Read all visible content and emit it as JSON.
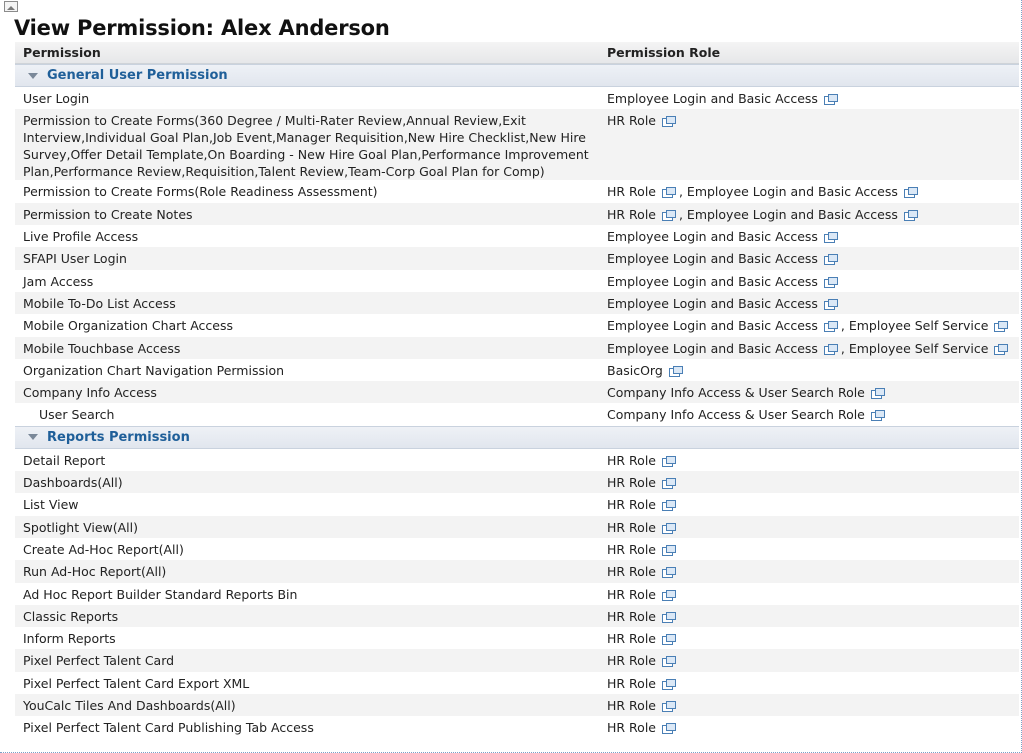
{
  "page": {
    "title": "View Permission: Alex Anderson"
  },
  "table": {
    "col_permission": "Permission",
    "col_role": "Permission Role"
  },
  "sections": [
    {
      "title": "General User Permission",
      "rows": [
        {
          "permission": "User Login",
          "roles": [
            "Employee Login and Basic Access"
          ]
        },
        {
          "permission": "Permission to Create Forms(360 Degree / Multi-Rater Review,Annual Review,Exit Interview,Individual Goal Plan,Job Event,Manager Requisition,New Hire Checklist,New Hire Survey,Offer Detail Template,On Boarding - New Hire Goal Plan,Performance Improvement Plan,Performance Review,Requisition,Talent Review,Team-Corp Goal Plan for Comp)",
          "roles": [
            "HR Role"
          ]
        },
        {
          "permission": "Permission to Create Forms(Role Readiness Assessment)",
          "roles": [
            "HR Role",
            "Employee Login and Basic Access"
          ]
        },
        {
          "permission": "Permission to Create Notes",
          "roles": [
            "HR Role",
            "Employee Login and Basic Access"
          ]
        },
        {
          "permission": "Live Profile Access",
          "roles": [
            "Employee Login and Basic Access"
          ]
        },
        {
          "permission": "SFAPI User Login",
          "roles": [
            "Employee Login and Basic Access"
          ]
        },
        {
          "permission": "Jam Access",
          "roles": [
            "Employee Login and Basic Access"
          ]
        },
        {
          "permission": "Mobile To-Do List Access",
          "roles": [
            "Employee Login and Basic Access"
          ]
        },
        {
          "permission": "Mobile Organization Chart Access",
          "roles": [
            "Employee Login and Basic Access",
            "Employee Self Service"
          ]
        },
        {
          "permission": "Mobile Touchbase Access",
          "roles": [
            "Employee Login and Basic Access",
            "Employee Self Service"
          ]
        },
        {
          "permission": "Organization Chart Navigation Permission",
          "roles": [
            "BasicOrg"
          ]
        },
        {
          "permission": "Company Info Access",
          "roles": [
            "Company Info Access & User Search Role"
          ]
        },
        {
          "permission": "User Search",
          "roles": [
            "Company Info Access & User Search Role"
          ],
          "indent": true
        }
      ]
    },
    {
      "title": "Reports Permission",
      "rows": [
        {
          "permission": "Detail Report",
          "roles": [
            "HR Role"
          ]
        },
        {
          "permission": "Dashboards(All)",
          "roles": [
            "HR Role"
          ]
        },
        {
          "permission": "List View",
          "roles": [
            "HR Role"
          ]
        },
        {
          "permission": "Spotlight View(All)",
          "roles": [
            "HR Role"
          ]
        },
        {
          "permission": "Create Ad-Hoc Report(All)",
          "roles": [
            "HR Role"
          ]
        },
        {
          "permission": "Run Ad-Hoc Report(All)",
          "roles": [
            "HR Role"
          ]
        },
        {
          "permission": "Ad Hoc Report Builder Standard Reports Bin",
          "roles": [
            "HR Role"
          ]
        },
        {
          "permission": "Classic Reports",
          "roles": [
            "HR Role"
          ]
        },
        {
          "permission": "Inform Reports",
          "roles": [
            "HR Role"
          ]
        },
        {
          "permission": "Pixel Perfect Talent Card",
          "roles": [
            "HR Role"
          ]
        },
        {
          "permission": "Pixel Perfect Talent Card Export XML",
          "roles": [
            "HR Role"
          ]
        },
        {
          "permission": "YouCalc Tiles And Dashboards(All)",
          "roles": [
            "HR Role"
          ]
        },
        {
          "permission": "Pixel Perfect Talent Card Publishing Tab Access",
          "roles": [
            "HR Role"
          ]
        }
      ]
    }
  ],
  "separator": " , ",
  "icons": {
    "role_link": "external-window-icon",
    "section_toggle": "collapse-triangle-icon",
    "corner": "broken-image-icon"
  }
}
